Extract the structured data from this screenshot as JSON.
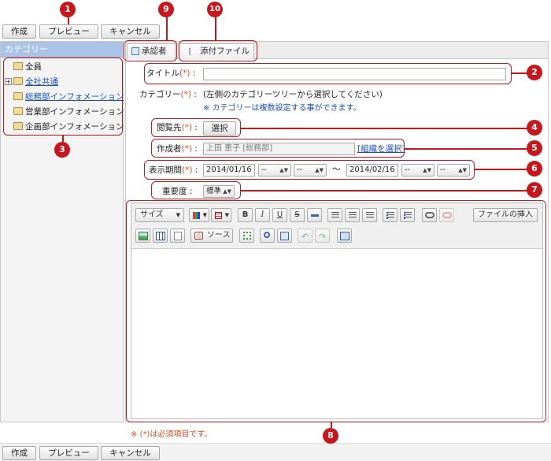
{
  "top_buttons": {
    "create": "作成",
    "preview": "プレビュー",
    "cancel": "キャンセル"
  },
  "bottom_buttons": {
    "create": "作成",
    "preview": "プレビュー",
    "cancel": "キャンセル"
  },
  "sidebar": {
    "header": "カテゴリー",
    "items": [
      {
        "label": "全員"
      },
      {
        "label": "全社共通"
      },
      {
        "label": "総務部インフォメーション"
      },
      {
        "label": "営業部インフォメーション"
      },
      {
        "label": "企画部インフォメーション"
      }
    ],
    "expand_symbol": "+"
  },
  "tabs": {
    "approver": "承認者",
    "attachment": "添付ファイル"
  },
  "form": {
    "title_label": "タイトル",
    "required_mark": "(*)",
    "colon": ":",
    "title_value": "",
    "category_label": "カテゴリー",
    "category_text": "(左側のカテゴリーツリーから選択してください)",
    "category_note": "※ カテゴリーは複数設定する事ができます。",
    "viewer_label": "閲覧先",
    "viewer_button": "選択",
    "author_label": "作成者",
    "author_value": "上田 恵子 [総務部]",
    "author_link": "[組織を選択]",
    "period_label": "表示期間",
    "start_date": "2014/01/16",
    "end_date": "2014/02/16",
    "dash": "--",
    "tilde": "〜",
    "importance_label": "重要度",
    "importance_value": "標準"
  },
  "editor": {
    "size_label": "サイズ",
    "insert_file": "ファイルの挿入",
    "source": "ソース",
    "bold": "B",
    "italic": "I",
    "underline": "U",
    "strike": "S"
  },
  "footer_note": "※ (*)は必須項目です。",
  "badges": [
    "1",
    "2",
    "3",
    "4",
    "5",
    "6",
    "7",
    "8",
    "9",
    "10"
  ],
  "colors": {
    "accent": "#c8161d",
    "sidebar_header": "#a9c4e6",
    "link": "#1a4ec0",
    "required": "#e04a1c"
  }
}
